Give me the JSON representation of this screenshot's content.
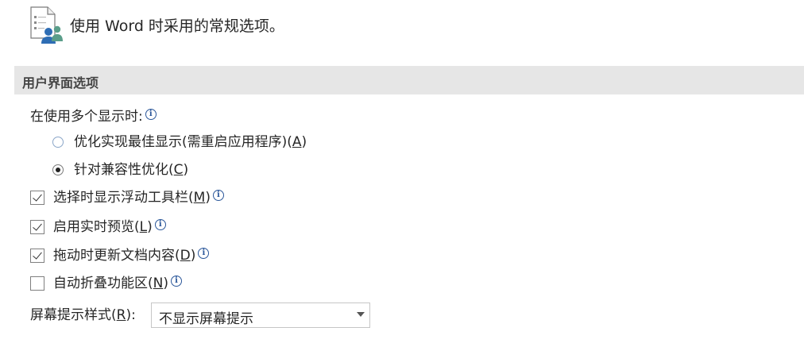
{
  "header": {
    "icon": "general-options-icon",
    "description": "使用 Word 时采用的常规选项。"
  },
  "section": {
    "title": "用户界面选项"
  },
  "multi_display": {
    "label": "在使用多个显示时:",
    "info_icon_glyph": "i",
    "options": [
      {
        "text": "优化实现最佳显示(需重启应用程序)(",
        "key": "A",
        "suffix": ")",
        "selected": false
      },
      {
        "text": "针对兼容性优化(",
        "key": "C",
        "suffix": ")",
        "selected": true
      }
    ]
  },
  "checkboxes": [
    {
      "text": "选择时显示浮动工具栏(",
      "key": "M",
      "suffix": ")",
      "checked": true
    },
    {
      "text": "启用实时预览(",
      "key": "L",
      "suffix": ")",
      "checked": true
    },
    {
      "text": "拖动时更新文档内容(",
      "key": "D",
      "suffix": ")",
      "checked": true
    },
    {
      "text": "自动折叠功能区(",
      "key": "N",
      "suffix": ")",
      "checked": false
    }
  ],
  "screentip": {
    "label_text": "屏幕提示样式(",
    "label_key": "R",
    "label_suffix": "):",
    "selected_value": "不显示屏幕提示"
  },
  "colors": {
    "section_bg": "#e6e6e6",
    "info_icon": "#2b579a",
    "icon_person_blue": "#2e6db4",
    "icon_person_green": "#5a9e8a"
  }
}
